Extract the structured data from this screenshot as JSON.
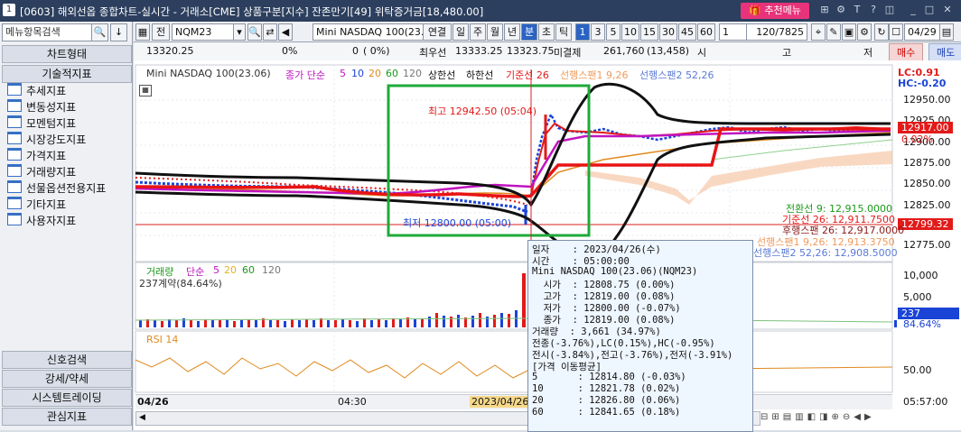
{
  "title_bar": {
    "number": "1",
    "title": "[0603] 해외선옵 종합차트-실시간 - 거래소[CME] 상품구분[지수] 잔존만기[49] 위탁증거금[18,480.00]",
    "menu_button": "추천메뉴"
  },
  "left_panel": {
    "search_placeholder": "메뉴항목검색",
    "sections": [
      "차트형태",
      "기술적지표"
    ],
    "tree_items": [
      "추세지표",
      "변동성지표",
      "모멘텀지표",
      "시장강도지표",
      "가격지표",
      "거래량지표",
      "선물옵션전용지표",
      "기타지표",
      "사용자지표"
    ],
    "bottom_buttons": [
      "신호검색",
      "강세/약세",
      "시스템트레이딩",
      "관심지표"
    ]
  },
  "toolbar": {
    "label_all": "전",
    "symbol": "NQM23",
    "product_name": "Mini NASDAQ 100(23.0",
    "period_buttons": [
      "연결",
      "일",
      "주",
      "월",
      "년",
      "분",
      "초",
      "틱"
    ],
    "active_period": "분",
    "intervals": [
      "1",
      "3",
      "5",
      "10",
      "15",
      "30",
      "45",
      "60"
    ],
    "active_interval": "1",
    "interval_select": "1",
    "page_count": "120/7825",
    "date": "04/29"
  },
  "quote_bar": {
    "price": "13320.25",
    "change_pct": "0%",
    "volume_zero": "0",
    "paren": "( 0%)",
    "best_ask_label": "최우선",
    "best_ask": "13333.25",
    "best_bid": "13323.75",
    "open_interest_label": "미결제",
    "open_interest": "261,760",
    "oi_change": "(13,458)",
    "time_label": "시",
    "range_label": "고",
    "low_label": "저",
    "sell_button": "매수",
    "buy_button": "매도"
  },
  "price_pane": {
    "legend": [
      "Mini NASDAQ 100(23.06)",
      "종가 단순",
      "5",
      "10",
      "20",
      "60",
      "120",
      "상한선",
      "하한선",
      "기준선 26",
      "선행스팬1 9,26",
      "선행스팬2 52,26"
    ],
    "hilo_labels": [
      "LC:0.91",
      "HC:-0.20"
    ],
    "high_annotation": "최고 12942.50 (05:04)",
    "low_annotation": "최저 12800.00 (05:00)",
    "y_ticks": [
      "12950.00",
      "12925.00",
      "12900.00",
      "12875.00",
      "12850.00",
      "12825.00",
      "12800.00",
      "12775.00"
    ],
    "current_price": "12917.00",
    "current_pct": "0.02%",
    "ref_price": "12799.32",
    "indicator_values": [
      "전환선 9: 12,915.0000",
      "기준선 26: 12,911.7500",
      "후행스팬 26: 12,917.0000",
      "선행스팬1 9,26: 12,913.3750",
      "선행스팬2 52,26: 12,908.5000"
    ]
  },
  "volume_pane": {
    "legend": [
      "거래량",
      "단순",
      "5",
      "20",
      "60",
      "120"
    ],
    "subtitle": "237계약(84.64%)",
    "y_ticks": [
      "10,000",
      "5,000"
    ],
    "current": "237",
    "current_pct": "84.64%"
  },
  "rsi_pane": {
    "legend": "RSI 14",
    "y_ticks": [
      "50.00"
    ]
  },
  "x_axis": {
    "labels": [
      "04/26",
      "04:30",
      "2023/04/26"
    ],
    "right_time": "05:57:00"
  },
  "tooltip": {
    "lines": [
      "일자    : 2023/04/26(수)",
      "시간    : 05:00:00",
      "Mini NASDAQ 100(23.06)(NQM23)",
      "  시가  : 12808.75 (0.00%)",
      "  고가  : 12819.00 (0.08%)",
      "  저가  : 12800.00 (-0.07%)",
      "  종가  : 12819.00 (0.08%)",
      "거래량  : 3,661 (34.97%)",
      "전종(-3.76%),LC(0.15%),HC(-0.95%)",
      "전시(-3.84%),전고(-3.76%),전저(-3.91%)",
      "[가격 이동평균]",
      "5       : 12814.80 (-0.03%)",
      "10      : 12821.78 (0.02%)",
      "20      : 12826.80 (0.06%)",
      "60      : 12841.65 (0.18%)"
    ]
  },
  "colors": {
    "titlebar": "#2c3f5e",
    "accent": "#e8337a",
    "up": "#e21a1a",
    "down": "#1a44d6",
    "highlight_box": "#1faa3a"
  }
}
